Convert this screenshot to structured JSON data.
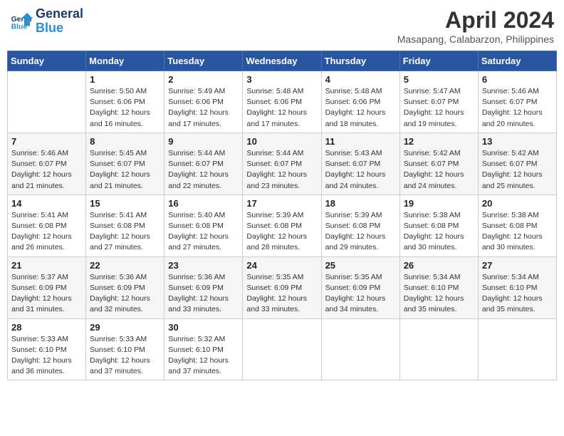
{
  "header": {
    "logo_line1": "General",
    "logo_line2": "Blue",
    "month_title": "April 2024",
    "location": "Masapang, Calabarzon, Philippines"
  },
  "days_of_week": [
    "Sunday",
    "Monday",
    "Tuesday",
    "Wednesday",
    "Thursday",
    "Friday",
    "Saturday"
  ],
  "weeks": [
    [
      {
        "day": "",
        "info": ""
      },
      {
        "day": "1",
        "info": "Sunrise: 5:50 AM\nSunset: 6:06 PM\nDaylight: 12 hours and 16 minutes."
      },
      {
        "day": "2",
        "info": "Sunrise: 5:49 AM\nSunset: 6:06 PM\nDaylight: 12 hours and 17 minutes."
      },
      {
        "day": "3",
        "info": "Sunrise: 5:48 AM\nSunset: 6:06 PM\nDaylight: 12 hours and 17 minutes."
      },
      {
        "day": "4",
        "info": "Sunrise: 5:48 AM\nSunset: 6:06 PM\nDaylight: 12 hours and 18 minutes."
      },
      {
        "day": "5",
        "info": "Sunrise: 5:47 AM\nSunset: 6:07 PM\nDaylight: 12 hours and 19 minutes."
      },
      {
        "day": "6",
        "info": "Sunrise: 5:46 AM\nSunset: 6:07 PM\nDaylight: 12 hours and 20 minutes."
      }
    ],
    [
      {
        "day": "7",
        "info": "Sunrise: 5:46 AM\nSunset: 6:07 PM\nDaylight: 12 hours and 21 minutes."
      },
      {
        "day": "8",
        "info": "Sunrise: 5:45 AM\nSunset: 6:07 PM\nDaylight: 12 hours and 21 minutes."
      },
      {
        "day": "9",
        "info": "Sunrise: 5:44 AM\nSunset: 6:07 PM\nDaylight: 12 hours and 22 minutes."
      },
      {
        "day": "10",
        "info": "Sunrise: 5:44 AM\nSunset: 6:07 PM\nDaylight: 12 hours and 23 minutes."
      },
      {
        "day": "11",
        "info": "Sunrise: 5:43 AM\nSunset: 6:07 PM\nDaylight: 12 hours and 24 minutes."
      },
      {
        "day": "12",
        "info": "Sunrise: 5:42 AM\nSunset: 6:07 PM\nDaylight: 12 hours and 24 minutes."
      },
      {
        "day": "13",
        "info": "Sunrise: 5:42 AM\nSunset: 6:07 PM\nDaylight: 12 hours and 25 minutes."
      }
    ],
    [
      {
        "day": "14",
        "info": "Sunrise: 5:41 AM\nSunset: 6:08 PM\nDaylight: 12 hours and 26 minutes."
      },
      {
        "day": "15",
        "info": "Sunrise: 5:41 AM\nSunset: 6:08 PM\nDaylight: 12 hours and 27 minutes."
      },
      {
        "day": "16",
        "info": "Sunrise: 5:40 AM\nSunset: 6:08 PM\nDaylight: 12 hours and 27 minutes."
      },
      {
        "day": "17",
        "info": "Sunrise: 5:39 AM\nSunset: 6:08 PM\nDaylight: 12 hours and 28 minutes."
      },
      {
        "day": "18",
        "info": "Sunrise: 5:39 AM\nSunset: 6:08 PM\nDaylight: 12 hours and 29 minutes."
      },
      {
        "day": "19",
        "info": "Sunrise: 5:38 AM\nSunset: 6:08 PM\nDaylight: 12 hours and 30 minutes."
      },
      {
        "day": "20",
        "info": "Sunrise: 5:38 AM\nSunset: 6:08 PM\nDaylight: 12 hours and 30 minutes."
      }
    ],
    [
      {
        "day": "21",
        "info": "Sunrise: 5:37 AM\nSunset: 6:09 PM\nDaylight: 12 hours and 31 minutes."
      },
      {
        "day": "22",
        "info": "Sunrise: 5:36 AM\nSunset: 6:09 PM\nDaylight: 12 hours and 32 minutes."
      },
      {
        "day": "23",
        "info": "Sunrise: 5:36 AM\nSunset: 6:09 PM\nDaylight: 12 hours and 33 minutes."
      },
      {
        "day": "24",
        "info": "Sunrise: 5:35 AM\nSunset: 6:09 PM\nDaylight: 12 hours and 33 minutes."
      },
      {
        "day": "25",
        "info": "Sunrise: 5:35 AM\nSunset: 6:09 PM\nDaylight: 12 hours and 34 minutes."
      },
      {
        "day": "26",
        "info": "Sunrise: 5:34 AM\nSunset: 6:10 PM\nDaylight: 12 hours and 35 minutes."
      },
      {
        "day": "27",
        "info": "Sunrise: 5:34 AM\nSunset: 6:10 PM\nDaylight: 12 hours and 35 minutes."
      }
    ],
    [
      {
        "day": "28",
        "info": "Sunrise: 5:33 AM\nSunset: 6:10 PM\nDaylight: 12 hours and 36 minutes."
      },
      {
        "day": "29",
        "info": "Sunrise: 5:33 AM\nSunset: 6:10 PM\nDaylight: 12 hours and 37 minutes."
      },
      {
        "day": "30",
        "info": "Sunrise: 5:32 AM\nSunset: 6:10 PM\nDaylight: 12 hours and 37 minutes."
      },
      {
        "day": "",
        "info": ""
      },
      {
        "day": "",
        "info": ""
      },
      {
        "day": "",
        "info": ""
      },
      {
        "day": "",
        "info": ""
      }
    ]
  ]
}
